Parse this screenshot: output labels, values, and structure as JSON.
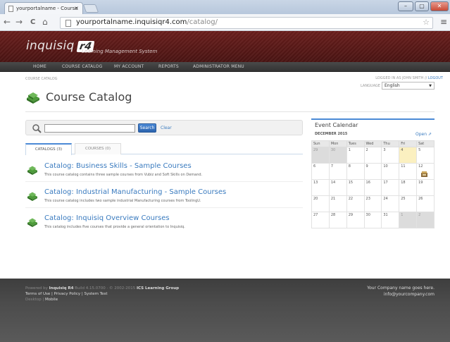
{
  "browser": {
    "tab_title": "yourportalname - Course",
    "tab_close": "×",
    "url_host": "yourportalname.inquisiqr4.com",
    "url_path": "/catalog/",
    "minimize": "–",
    "maximize": "▢",
    "close": "✕",
    "back": "←",
    "forward": "→",
    "reload": "C",
    "home": "⌂",
    "star": "☆",
    "menu": "≡"
  },
  "site": {
    "logo_text": "inquisiq",
    "logo_badge": "r4",
    "tagline": "Learning Management System",
    "nav": [
      "HOME",
      "COURSE CATALOG",
      "MY ACCOUNT",
      "REPORTS",
      "ADMINISTRATOR MENU"
    ]
  },
  "page": {
    "breadcrumb": "COURSE CATALOG",
    "logged_in": "LOGGED IN AS JOHN SMITH //",
    "logout": "LOGOUT",
    "language_label": "LANGUAGE",
    "language_value": "English",
    "caret": "▼",
    "title": "Course Catalog"
  },
  "search": {
    "button": "Search",
    "clear": "Clear"
  },
  "tabs": [
    "CATALOGS (3)",
    "COURSES (0)"
  ],
  "catalogs": [
    {
      "title": "Catalog: Business Skills - Sample Courses",
      "desc": "This course catalog contains three sample courses from Vubiz and Soft Skills on Demand."
    },
    {
      "title": "Catalog: Industrial Manufacturing - Sample Courses",
      "desc": "This course catalog includes two sample industrial Manufacturing courses from ToolingU."
    },
    {
      "title": "Catalog: Inquisiq Overview Courses",
      "desc": "This catalog includes five courses that provide a general orientation to Inquisiq."
    }
  ],
  "calendar": {
    "title": "Event Calendar",
    "month": "DECEMBER 2015",
    "open": "Open",
    "open_icon": "⇗",
    "days": [
      "Sun",
      "Mon",
      "Tues",
      "Wed",
      "Thu",
      "Fri",
      "Sat"
    ],
    "weeks": [
      [
        "29",
        "30",
        "1",
        "2",
        "3",
        "4",
        "5"
      ],
      [
        "6",
        "7",
        "8",
        "9",
        "10",
        "11",
        "12"
      ],
      [
        "13",
        "14",
        "15",
        "16",
        "17",
        "18",
        "19"
      ],
      [
        "20",
        "21",
        "22",
        "23",
        "24",
        "25",
        "26"
      ],
      [
        "27",
        "28",
        "29",
        "30",
        "31",
        "1",
        "2"
      ]
    ]
  },
  "footer": {
    "powered_by": "Powered by",
    "product": "Inquisiq R4",
    "build": "Build 4.15.0700 · © 2002-2015",
    "company": "ICS Learning Group",
    "terms": "Terms of Use",
    "privacy": "Privacy Policy",
    "system_test": "System Test",
    "desktop": "Desktop",
    "mobile": "Mobile",
    "sep": " | ",
    "right_line1": "Your Company name goes here.",
    "right_line2": "info@yourcompany.com"
  },
  "colors": {
    "header": "#5a1a18",
    "link": "#3a7bbf",
    "accent": "#4b8ad6"
  }
}
